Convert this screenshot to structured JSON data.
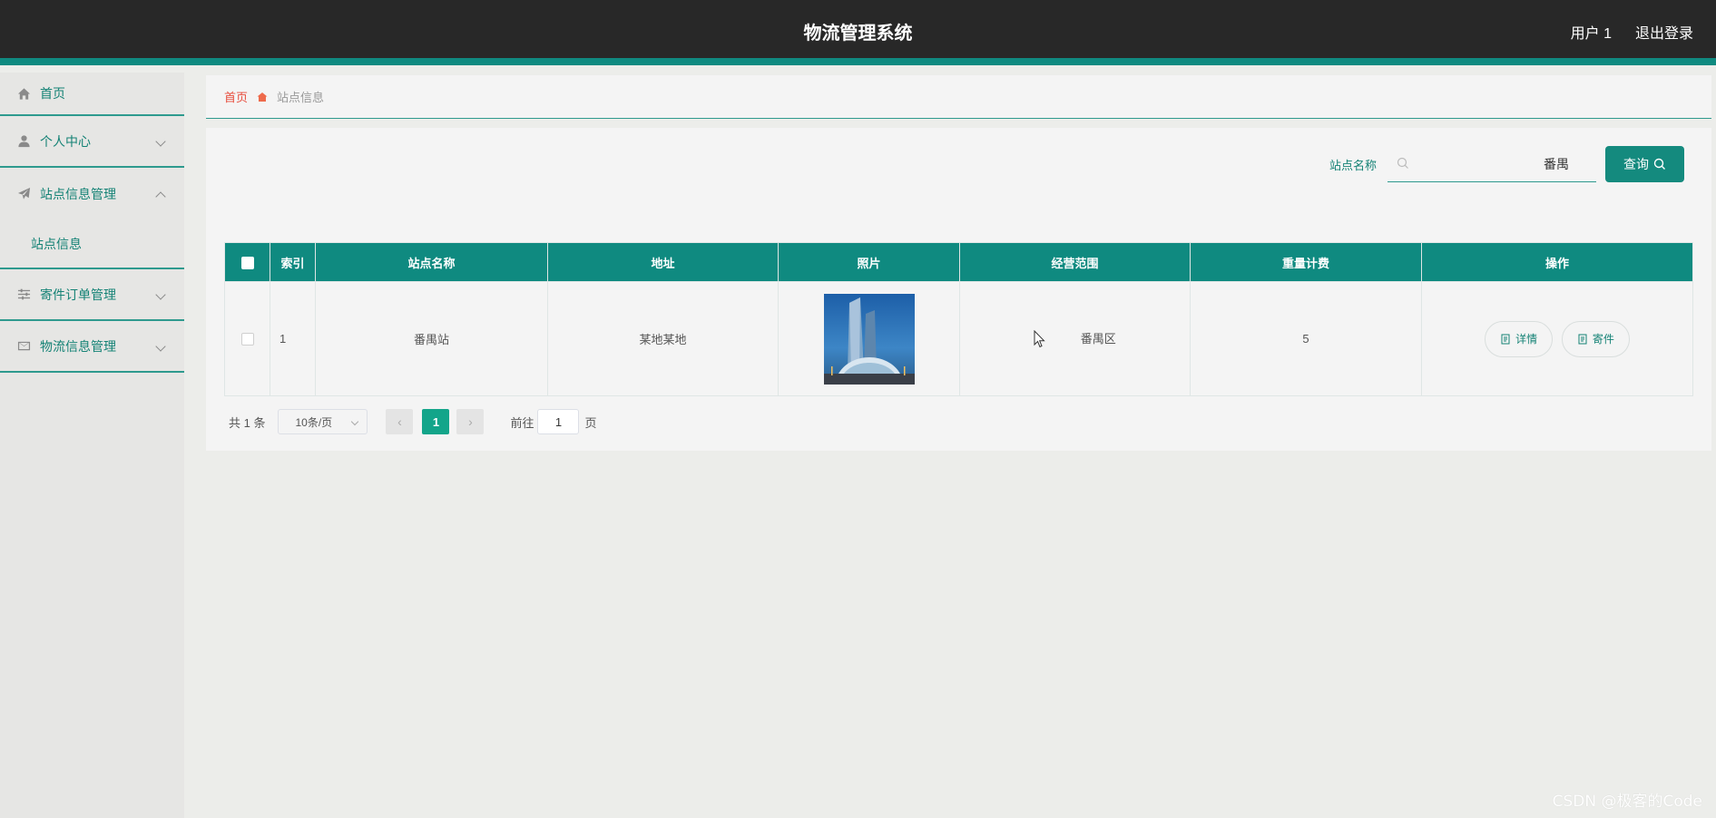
{
  "app": {
    "title": "物流管理系统",
    "user": "用户 1",
    "logout": "退出登录"
  },
  "sidebar": {
    "items": [
      {
        "label": "首页",
        "icon": "home-icon"
      },
      {
        "label": "个人中心",
        "icon": "user-icon"
      },
      {
        "label": "站点信息管理",
        "icon": "paper-plane-icon"
      },
      {
        "label": "站点信息"
      },
      {
        "label": "寄件订单管理",
        "icon": "sliders-icon"
      },
      {
        "label": "物流信息管理",
        "icon": "mail-icon"
      }
    ]
  },
  "breadcrumb": {
    "home": "首页",
    "current": "站点信息"
  },
  "search": {
    "label": "站点名称",
    "value": "番禺",
    "button": "查询"
  },
  "table": {
    "headers": [
      "索引",
      "站点名称",
      "地址",
      "照片",
      "经营范围",
      "重量计费",
      "操作"
    ],
    "rows": [
      {
        "index": "1",
        "name": "番禺站",
        "address": "某地某地",
        "scope": "番禺区",
        "weight_fee": "5",
        "actions": [
          "详情",
          "寄件"
        ]
      }
    ]
  },
  "pagination": {
    "total": "共 1 条",
    "page_size": "10条/页",
    "current_page": "1",
    "goto_label": "前往",
    "goto_value": "1",
    "page_suffix": "页"
  },
  "watermark": "CSDN @极客的Code",
  "colors": {
    "accent": "#0f8a80",
    "header_bg": "#282828",
    "active_page": "#13a58a"
  }
}
